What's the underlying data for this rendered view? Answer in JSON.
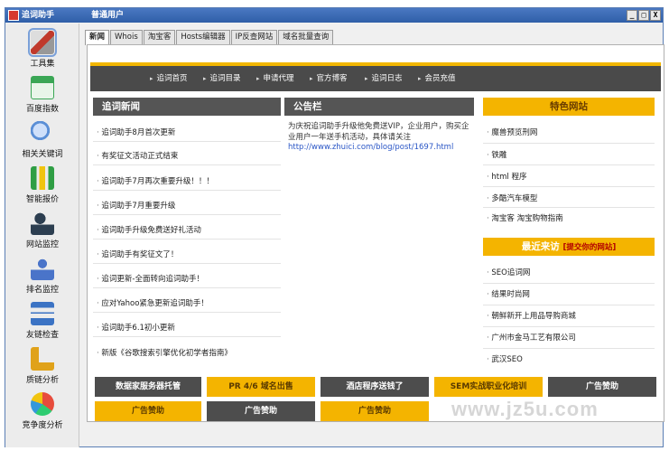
{
  "window": {
    "title": "追词助手",
    "user_status": "普通用户",
    "controls": [
      "_",
      "□",
      "X"
    ]
  },
  "sidebar": {
    "items": [
      {
        "label": "工具集",
        "icon": "tools-icon",
        "color": "#c0392b"
      },
      {
        "label": "百度指数",
        "icon": "chart-board-icon",
        "color": "#3aa655"
      },
      {
        "label": "相关关键词",
        "icon": "magnifier-icon",
        "color": "#5b8fd6"
      },
      {
        "label": "智能报价",
        "icon": "bar-chart-icon",
        "color": "#2f9e44"
      },
      {
        "label": "网站监控",
        "icon": "person-monitor-icon",
        "color": "#2c3e50"
      },
      {
        "label": "排名监控",
        "icon": "user-icon",
        "color": "#4a74c9"
      },
      {
        "label": "友链检查",
        "icon": "sitemap-icon",
        "color": "#3b73c4"
      },
      {
        "label": "质链分析",
        "icon": "ruler-icon",
        "color": "#e0a21a"
      },
      {
        "label": "竞争度分析",
        "icon": "pie-chart-icon",
        "color": "#e67e22"
      }
    ]
  },
  "tabs": [
    "新闻",
    "Whois",
    "淘宝客",
    "Hosts编辑器",
    "IP反查网站",
    "域名批量查询"
  ],
  "nav": [
    "追词首页",
    "追词目录",
    "申请代理",
    "官方博客",
    "追词日志",
    "会员充值"
  ],
  "news": {
    "title": "追词新闻",
    "items": [
      "追词助手8月首次更新",
      "有奖征文活动正式结束",
      "追词助手7月再次重要升级！！！",
      "追词助手7月重要升级",
      "追词助手升级免费送好礼活动",
      "追词助手有奖征文了！",
      "追词更新-全面转向追词助手！",
      "应对Yahoo紧急更新追词助手！",
      "追词助手6.1初小更新",
      "新版《谷歌搜索引擎优化初学者指南》"
    ]
  },
  "notice": {
    "title": "公告栏",
    "text": "为庆祝追词助手升级他免费送VIP，企业用户，购买企业用户一年送手机活动，具体请关注",
    "link": "http://www.zhuici.com/blog/post/1697.html"
  },
  "featured": {
    "title": "特色网站",
    "items": [
      "魔兽预览刑网",
      "铁雕",
      "html 程序",
      "多酷汽车模型",
      "淘宝客 淘宝购物指南"
    ]
  },
  "recent": {
    "title": "最近来访",
    "submit": "[提交你的网站]",
    "items": [
      "SEO追词网",
      "结果时尚网",
      "朝鲜新开上用品导购商城",
      "广州市金马工艺有限公司",
      "武汉SEO"
    ]
  },
  "ads": {
    "row1": [
      "数据家服务器托管",
      "PR 4/6 域名出售",
      "酒店程序送钱了",
      "SEM实战职业化培训",
      "广告赞助"
    ],
    "row2": [
      "广告赞助",
      "广告赞助",
      "广告赞助"
    ]
  },
  "watermark": "www.jz5u.com"
}
